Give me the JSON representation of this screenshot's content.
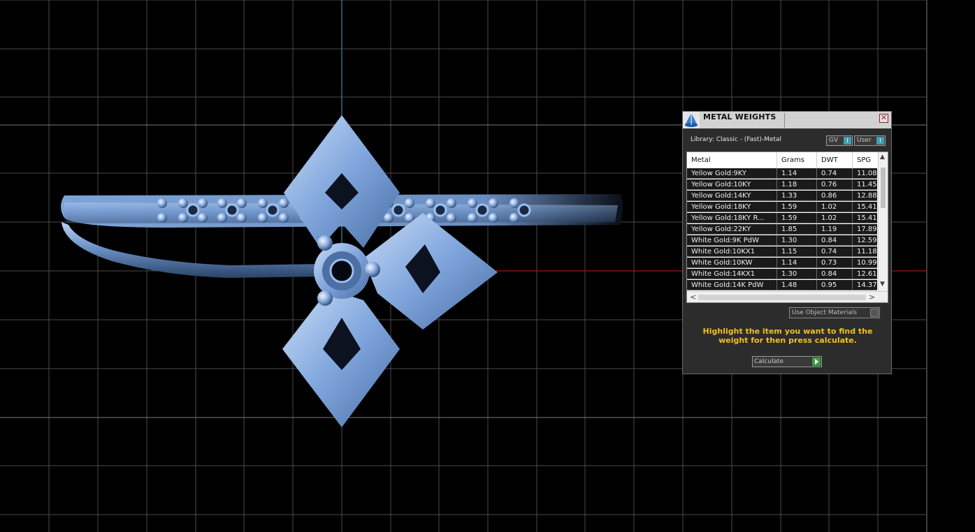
{
  "panel": {
    "title": "METAL WEIGHTS",
    "close_label": "✕",
    "library_label": "Library: Classic - (Fast)-Metal",
    "toggle_gv": "GV",
    "toggle_user": "User",
    "toggle_knob": "I",
    "columns": [
      "Metal",
      "Grams",
      "DWT",
      "SPG"
    ],
    "rows": [
      [
        "Yellow Gold:9KY",
        "1.14",
        "0.74",
        "11.08"
      ],
      [
        "Yellow Gold:10KY",
        "1.18",
        "0.76",
        "11.45"
      ],
      [
        "Yellow Gold:14KY",
        "1.33",
        "0.86",
        "12.88"
      ],
      [
        "Yellow Gold:18KY",
        "1.59",
        "1.02",
        "15.41"
      ],
      [
        "Yellow Gold:18KY R...",
        "1.59",
        "1.02",
        "15.41"
      ],
      [
        "Yellow Gold:22KY",
        "1.85",
        "1.19",
        "17.89"
      ],
      [
        "White Gold:9K PdW",
        "1.30",
        "0.84",
        "12.59"
      ],
      [
        "White Gold:10KX1",
        "1.15",
        "0.74",
        "11.18"
      ],
      [
        "White Gold:10KW",
        "1.14",
        "0.73",
        "10.99"
      ],
      [
        "White Gold:14KX1",
        "1.30",
        "0.84",
        "12.61"
      ],
      [
        "White Gold:14K PdW",
        "1.48",
        "0.95",
        "14.37"
      ]
    ],
    "use_object_materials": "Use Object Materials",
    "hint": "Highlight the item you want to find the weight for then press calculate.",
    "calculate_label": "Calculate"
  },
  "scroll_arrows": {
    "up": "▲",
    "down": "▼",
    "left": "<",
    "right": ">"
  },
  "colors": {
    "background": "#000000",
    "grid": "#5a5a5a",
    "x_axis": "#a01810",
    "y_axis": "#2a8fa0",
    "ring_metal": "#7a9fd6",
    "hint_text": "#f0c020"
  }
}
